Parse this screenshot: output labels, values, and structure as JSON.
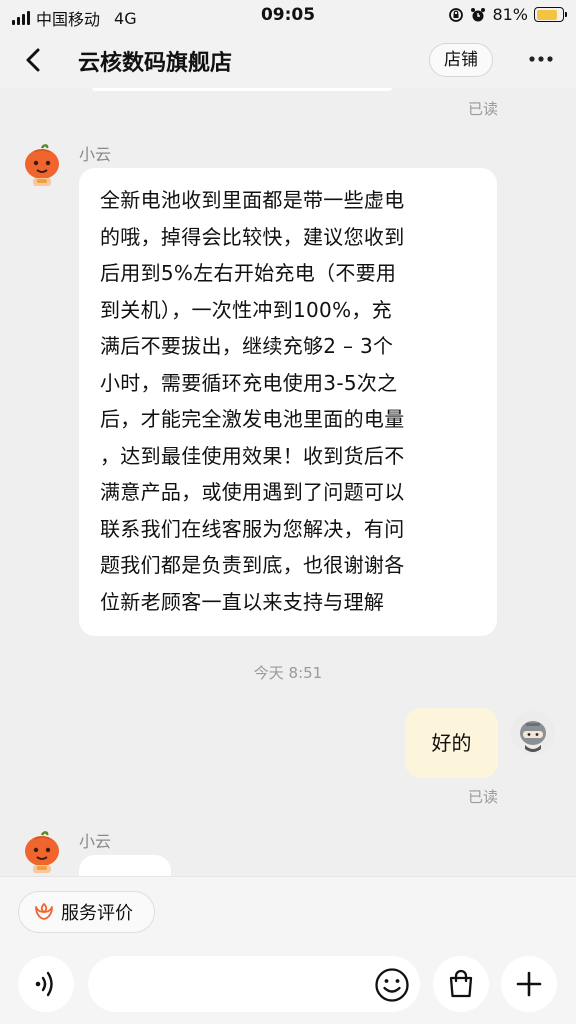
{
  "status_bar": {
    "carrier": "中国移动",
    "network": "4G",
    "time": "09:05",
    "battery_text": "81%",
    "battery_level": 0.81,
    "battery_color": "#f5c242"
  },
  "header": {
    "title": "云核数码旗舰店",
    "shop_button": "店铺",
    "more_icon": "more-dots-icon",
    "back_icon": "chevron-left-icon"
  },
  "chat": {
    "read_receipt_top": "已读",
    "messages": [
      {
        "sender": "小云",
        "lines": [
          "全新电池收到里面都是带一些虚电",
          "的哦，掉得会比较快，建议您收到",
          "后用到5%左右开始充电（不要用",
          "到关机），一次性冲到100%，充",
          "满后不要拔出，继续充够2 – 3个",
          "小时，需要循环充电使用3-5次之",
          "后，才能完全激发电池里面的电量",
          "，达到最佳使用效果！收到货后不",
          "满意产品，或使用遇到了问题可以",
          "联系我们在线客服为您解决，有问",
          "题我们都是负责到底，也很谢谢各",
          "位新老顾客一直以来支持与理解"
        ]
      },
      {
        "time_divider": "今天 8:51"
      },
      {
        "mine": true,
        "text": "好的",
        "read_receipt": "已读"
      },
      {
        "sender": "小云",
        "text": ""
      }
    ]
  },
  "bottom": {
    "rate_button": "服务评价",
    "rate_icon": "flower-icon",
    "voice_icon": "voice-icon",
    "emoji_icon": "smile-icon",
    "bag_icon": "shopping-bag-icon",
    "plus_icon": "plus-icon",
    "input_placeholder": ""
  },
  "colors": {
    "accent_orange": "#f0642d",
    "my_bubble": "#fdf4dc",
    "background": "#efefef"
  }
}
